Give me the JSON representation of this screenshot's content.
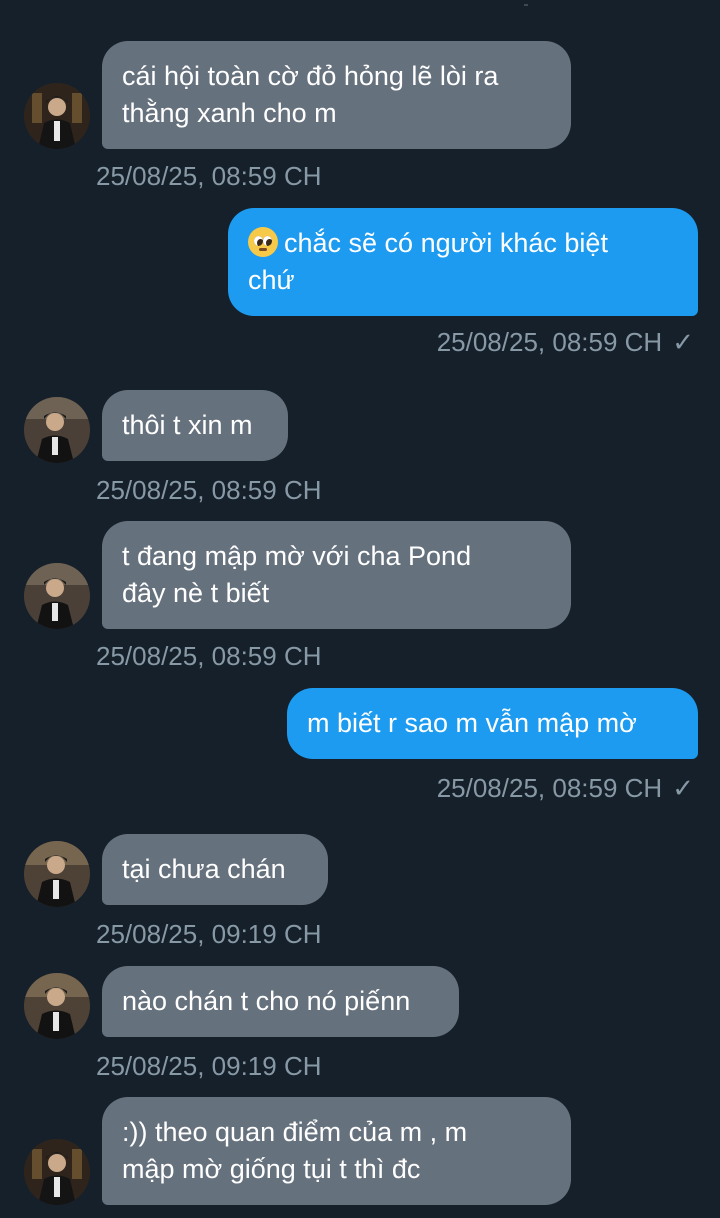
{
  "messages": [
    {
      "side": "in",
      "lines": [
        "cái hội toàn cờ đỏ hỏng lẽ lòi ra",
        "thằng xanh cho m"
      ],
      "time": "25/08/25, 08:59 CH"
    },
    {
      "side": "out",
      "emoji": "pleading-face",
      "lines": [
        "chắc sẽ có người khác biệt",
        "chứ"
      ],
      "time": "25/08/25, 08:59 CH",
      "check": "✓"
    },
    {
      "side": "in",
      "lines": [
        "thôi t xin m"
      ],
      "time": "25/08/25, 08:59 CH"
    },
    {
      "side": "in",
      "lines": [
        "t đang mập mờ với cha Pond",
        "đây nè t biết"
      ],
      "time": "25/08/25, 08:59 CH"
    },
    {
      "side": "out",
      "lines": [
        "m biết r sao m vẫn mập mờ"
      ],
      "time": "25/08/25, 08:59 CH",
      "check": "✓"
    },
    {
      "side": "in",
      "lines": [
        "tại chưa chán"
      ],
      "time": "25/08/25, 09:19 CH"
    },
    {
      "side": "in",
      "lines": [
        "nào chán t cho nó piếnn"
      ],
      "time": "25/08/25, 09:19 CH"
    },
    {
      "side": "in",
      "lines": [
        ":)) theo quan điểm của m , m",
        "mập mờ giống tụi t thì đc"
      ],
      "time": ""
    }
  ],
  "colors": {
    "background": "#15202b",
    "incoming_bubble": "#66717e",
    "outgoing_bubble": "#1d9bf0",
    "timestamp": "#8899a6",
    "text": "#ffffff"
  },
  "icons": {
    "avatar": "contact-avatar",
    "read_receipt": "check-icon",
    "emoji": "pleading-face-emoji"
  }
}
